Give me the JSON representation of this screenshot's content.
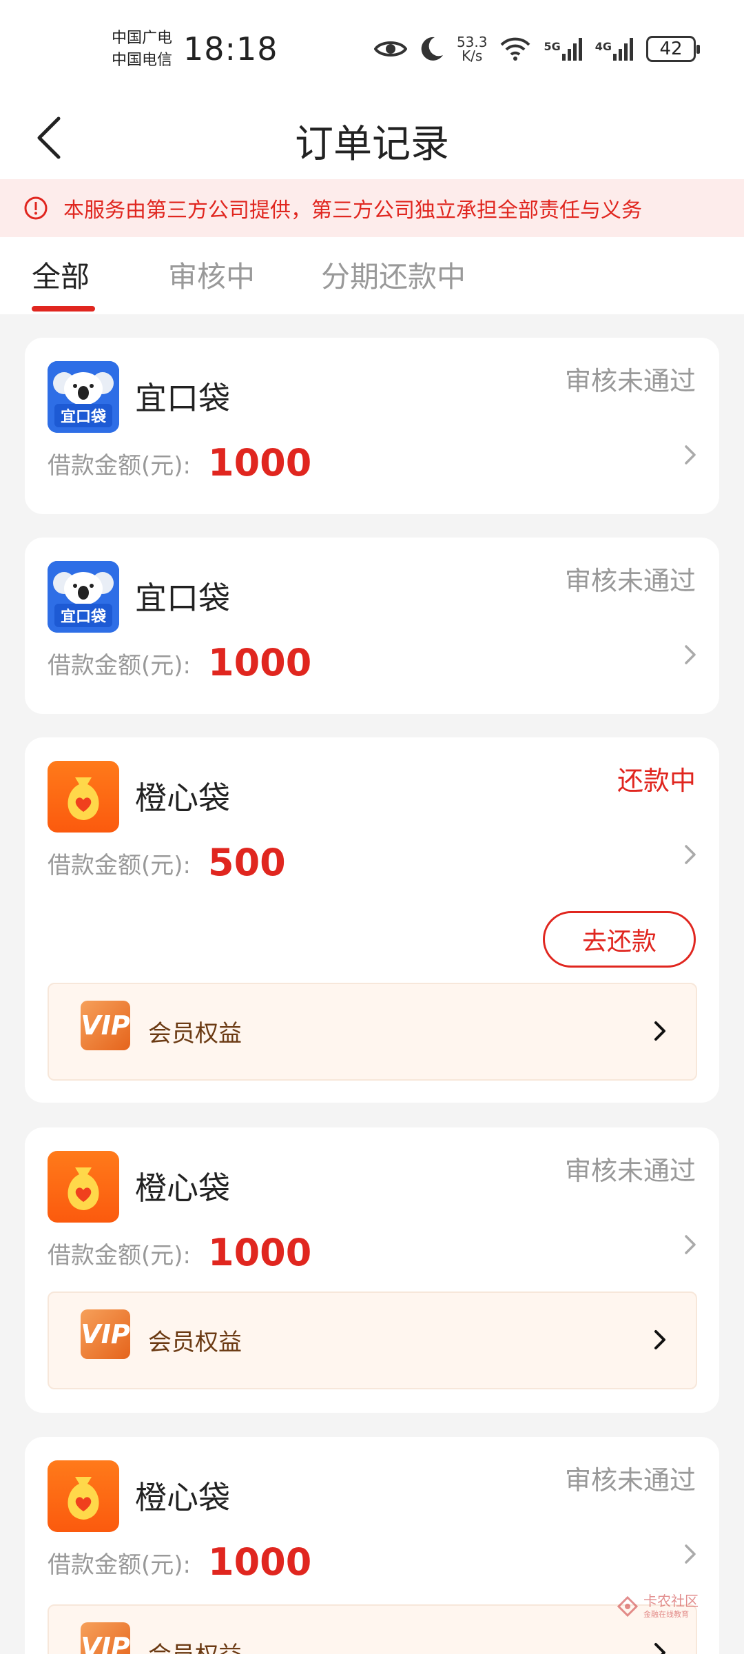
{
  "status_bar": {
    "carrier1": "中国广电",
    "carrier2": "中国电信",
    "time": "18:18",
    "speed_value": "53.3",
    "speed_unit": "K/s",
    "signal1_label": "5G",
    "signal2_label": "4G",
    "battery": "42"
  },
  "header": {
    "title": "订单记录"
  },
  "notice": {
    "text": "本服务由第三方公司提供，第三方公司独立承担全部责任与义务"
  },
  "tabs": [
    {
      "label": "全部",
      "active": true
    },
    {
      "label": "审核中",
      "active": false
    },
    {
      "label": "分期还款中",
      "active": false
    }
  ],
  "orders": [
    {
      "brand": "宜口袋",
      "logo": "koala-icon",
      "status": "审核未通过",
      "amount_label": "借款金额(元):",
      "amount": "1000"
    },
    {
      "brand": "宜口袋",
      "logo": "koala-icon",
      "status": "审核未通过",
      "amount_label": "借款金额(元):",
      "amount": "1000"
    },
    {
      "brand": "橙心袋",
      "logo": "money-bag-icon",
      "status": "还款中",
      "amount_label": "借款金额(元):",
      "amount": "500",
      "action": "去还款",
      "vip": "会员权益"
    },
    {
      "brand": "橙心袋",
      "logo": "money-bag-icon",
      "status": "审核未通过",
      "amount_label": "借款金额(元):",
      "amount": "1000",
      "vip": "会员权益"
    },
    {
      "brand": "橙心袋",
      "logo": "money-bag-icon",
      "status": "审核未通过",
      "amount_label": "借款金额(元):",
      "amount": "1000",
      "vip": "会员权益"
    }
  ],
  "koala_logo_text": "宜口袋",
  "vip_badge_text": "VIP",
  "watermark": {
    "text": "卡农社区",
    "sub": "金融在线教育"
  },
  "colors": {
    "accent": "#e0261f",
    "orange": "#fb6a12",
    "koala_blue": "#2e6ee6"
  }
}
